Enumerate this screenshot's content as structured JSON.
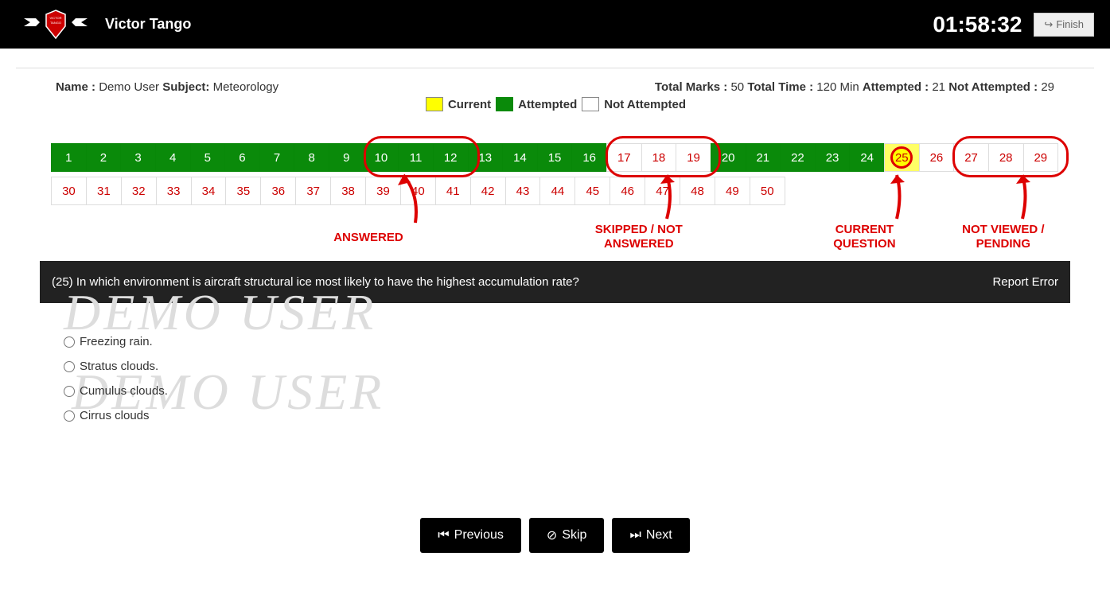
{
  "header": {
    "brand": "Victor Tango",
    "timer": "01:58:32",
    "finish_label": "Finish"
  },
  "info": {
    "name_label": "Name :",
    "name": "Demo User",
    "subject_label": "Subject:",
    "subject": "Meteorology",
    "total_marks_label": "Total Marks :",
    "total_marks": "50",
    "total_time_label": "Total Time :",
    "total_time": "120 Min",
    "attempted_label": "Attempted :",
    "attempted": "21",
    "not_attempted_label": "Not Attempted :",
    "not_attempted": "29"
  },
  "legend": {
    "current": "Current",
    "attempted": "Attempted",
    "not_attempted": "Not Attempted"
  },
  "questions": [
    {
      "n": "1",
      "s": "attempted"
    },
    {
      "n": "2",
      "s": "attempted"
    },
    {
      "n": "3",
      "s": "attempted"
    },
    {
      "n": "4",
      "s": "attempted"
    },
    {
      "n": "5",
      "s": "attempted"
    },
    {
      "n": "6",
      "s": "attempted"
    },
    {
      "n": "7",
      "s": "attempted"
    },
    {
      "n": "8",
      "s": "attempted"
    },
    {
      "n": "9",
      "s": "attempted"
    },
    {
      "n": "10",
      "s": "attempted"
    },
    {
      "n": "11",
      "s": "attempted"
    },
    {
      "n": "12",
      "s": "attempted"
    },
    {
      "n": "13",
      "s": "attempted"
    },
    {
      "n": "14",
      "s": "attempted"
    },
    {
      "n": "15",
      "s": "attempted"
    },
    {
      "n": "16",
      "s": "attempted"
    },
    {
      "n": "17",
      "s": "skipped"
    },
    {
      "n": "18",
      "s": "skipped"
    },
    {
      "n": "19",
      "s": "skipped"
    },
    {
      "n": "20",
      "s": "attempted"
    },
    {
      "n": "21",
      "s": "attempted"
    },
    {
      "n": "22",
      "s": "attempted"
    },
    {
      "n": "23",
      "s": "attempted"
    },
    {
      "n": "24",
      "s": "attempted"
    },
    {
      "n": "25",
      "s": "current"
    },
    {
      "n": "26",
      "s": "pending"
    },
    {
      "n": "27",
      "s": "pending"
    },
    {
      "n": "28",
      "s": "pending"
    },
    {
      "n": "29",
      "s": "pending"
    },
    {
      "n": "30",
      "s": "pending"
    },
    {
      "n": "31",
      "s": "pending"
    },
    {
      "n": "32",
      "s": "pending"
    },
    {
      "n": "33",
      "s": "pending"
    },
    {
      "n": "34",
      "s": "pending"
    },
    {
      "n": "35",
      "s": "pending"
    },
    {
      "n": "36",
      "s": "pending"
    },
    {
      "n": "37",
      "s": "pending"
    },
    {
      "n": "38",
      "s": "pending"
    },
    {
      "n": "39",
      "s": "pending"
    },
    {
      "n": "40",
      "s": "pending"
    },
    {
      "n": "41",
      "s": "pending"
    },
    {
      "n": "42",
      "s": "pending"
    },
    {
      "n": "43",
      "s": "pending"
    },
    {
      "n": "44",
      "s": "pending"
    },
    {
      "n": "45",
      "s": "pending"
    },
    {
      "n": "46",
      "s": "pending"
    },
    {
      "n": "47",
      "s": "pending"
    },
    {
      "n": "48",
      "s": "pending"
    },
    {
      "n": "49",
      "s": "pending"
    },
    {
      "n": "50",
      "s": "pending"
    }
  ],
  "annotations": {
    "answered": "ANSWERED",
    "skipped": "SKIPPED / NOT ANSWERED",
    "current": "CURRENT QUESTION",
    "pending": "NOT VIEWED / PENDING"
  },
  "question": {
    "text": "(25) In which environment is aircraft structural ice most likely to have the highest accumulation rate?",
    "report": "Report Error"
  },
  "options": [
    {
      "text": "Freezing rain."
    },
    {
      "text": "Stratus clouds."
    },
    {
      "text": "Cumulus clouds."
    },
    {
      "text": "Cirrus clouds"
    }
  ],
  "watermark": "DEMO USER",
  "nav": {
    "previous": "Previous",
    "skip": "Skip",
    "next": "Next"
  }
}
